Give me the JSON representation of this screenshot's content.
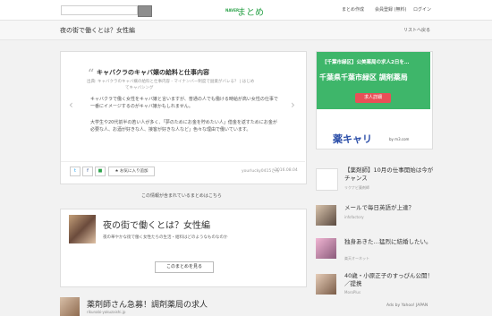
{
  "header": {
    "logo_small": "NAVER",
    "logo": "まとめ",
    "links": [
      "まとめ作成",
      "会員登録 (無料)",
      "ログイン"
    ]
  },
  "titlebar": {
    "title": "夜の街で働くとは？女性編",
    "back_link": "リストへ戻る"
  },
  "article": {
    "title": "キャバクラのキャバ嬢の給料と仕事内容",
    "source": "出典: キャバクラのキャバ嬢の給料と仕事内容 - マイナンバー制度で副業がバレる？ | はじめ",
    "source2": "てキャバシング",
    "para1": "キャバクラで働く女性をキャバ嬢と言いますが、普通の人でも働ける時給が高い女性の仕事で一番にイメージするのがキャバ嬢かもしれません。",
    "para2": "大学生や20代前半の若い人が多く、「夢のためにお金を貯めたい人」借金を返すためにお金が必要な人、お酒が好きな人、接客が好きな人など」色々な理由で働いています。",
    "fav_label": "お気に入り追加",
    "author": "yourlucky0415さん",
    "date": "2016.08.04"
  },
  "included": {
    "label": "この情報が含まれているまとめはこちら",
    "title": "夜の街で働くとは？女性編",
    "desc": "夜の華やかな街で働く女性たちの生活・給料はどのようなものなのか",
    "button": "このまとめを見る"
  },
  "bottom_ad": {
    "title": "薬剤師さん急募！調剤薬局の求人",
    "url": "rikunabi-yakuzaishi.jp"
  },
  "banner": {
    "line1": "【千葉市緑区】公美薬局の求人2日を…",
    "line2": "千葉県千葉市緑区 調剤薬局",
    "button": "求人詳細",
    "logo": "薬キャリ",
    "logo_sub": "by m3.com"
  },
  "side_items": [
    {
      "title": "【薬剤師】10月の仕事開始は今がチャンス",
      "src": "リクナビ薬剤師"
    },
    {
      "title": "メールで毎日英語が上達？",
      "src": "infofactory"
    },
    {
      "title": "独身あきた…猛烈に結婚したい。",
      "src": "楽天オーネット"
    },
    {
      "title": "40歳・小原正子のすっぴん公開！／提携",
      "src": "MoroPlus"
    }
  ],
  "ads_by": "Ads by Yahoo! JAPAN",
  "colors": {
    "brand": "#2da34b",
    "banner_green": "#3eb66a",
    "banner_red": "#e94f57"
  }
}
